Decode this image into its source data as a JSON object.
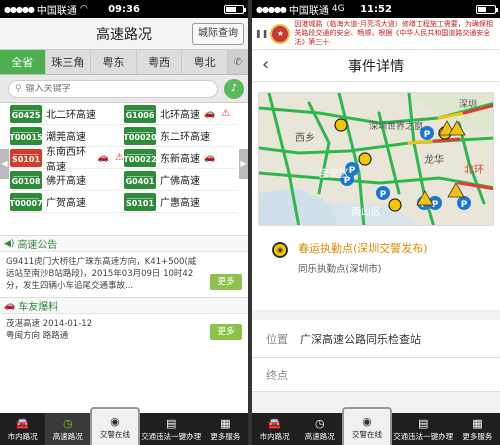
{
  "left": {
    "status": {
      "carrier": "中国联通",
      "network": "4G",
      "time": "09:36",
      "battery_level": 0.6
    },
    "nav": {
      "title": "高速路况",
      "city_button": "城际查询"
    },
    "regions": [
      "全省",
      "珠三角",
      "粤东",
      "粤西",
      "粤北"
    ],
    "search": {
      "placeholder": "输入关键字"
    },
    "roads": [
      {
        "code": "G0425",
        "name": "北二环高速",
        "color": "green",
        "car": false,
        "warn": false
      },
      {
        "code": "G1006",
        "name": "北环高速",
        "color": "green",
        "car": true,
        "warn": true
      },
      {
        "code": "T00015",
        "name": "潮莞高速",
        "color": "green",
        "car": false,
        "warn": false
      },
      {
        "code": "T00020",
        "name": "东二环高速",
        "color": "green",
        "car": false,
        "warn": false
      },
      {
        "code": "S0101",
        "name": "东南西环高速",
        "color": "red",
        "car": true,
        "warn": true
      },
      {
        "code": "T00022",
        "name": "东新高速",
        "color": "green",
        "car": true,
        "warn": false
      },
      {
        "code": "G0108",
        "name": "佛开高速",
        "color": "green",
        "car": false,
        "warn": false
      },
      {
        "code": "G0401",
        "name": "广佛高速",
        "color": "green",
        "car": false,
        "warn": false
      },
      {
        "code": "T00007",
        "name": "广贺高速",
        "color": "green",
        "car": false,
        "warn": false
      },
      {
        "code": "S0101",
        "name": "广惠高速",
        "color": "green",
        "car": false,
        "warn": false
      }
    ],
    "notice": {
      "title": "高速公告",
      "text": "G9411虎门大桥往广珠东高速方向，K41+500(威远站至南沙B站路段)，2015年03月09日 10时42分，发生四辆小车追尾交通事故...",
      "more": "更多"
    },
    "reports": {
      "title": "车友爆料",
      "line1": "茂湛高速 2014-01-12",
      "line2": "粤闽方向 路路通",
      "more": "更多"
    },
    "tabs": [
      "市内路况",
      "高速路况",
      "交警在线",
      "交通违法一键办理",
      "更多服务"
    ]
  },
  "right": {
    "status": {
      "carrier": "中国联通",
      "network": "4G",
      "time": "11:52",
      "battery_level": 0.5
    },
    "banner": "因港城路（临海大道-月亮湾大道）修缮工程施工需要，为确保相关路段交通的安全、畅顺，根据《中华人民共和国道路交通安全法》第三十",
    "nav": {
      "title": "事件详情"
    },
    "map_labels": [
      "深圳",
      "深圳世界之窗",
      "龙华",
      "西乡",
      "宝安区",
      "南山区",
      "北环"
    ],
    "event": {
      "title": "春运执勤点(深圳交警发布)",
      "subtitle": "同乐执勤点(深圳市)"
    },
    "location": {
      "label": "位置",
      "value": "广深高速公路同乐检查站"
    },
    "endpoint": {
      "label": "终点"
    },
    "tabs": [
      "市内路况",
      "高速路况",
      "交警在线",
      "交通违法一键办理",
      "更多服务"
    ]
  },
  "colors": {
    "accent_green": "#4caf50",
    "badge_green": "#2e8b3a",
    "badge_red": "#d73a2a",
    "more_green": "#8bc34a",
    "event_orange": "#e08b00",
    "road_green": "#2db84b",
    "road_red": "#e53935",
    "road_yellow": "#f4c20d"
  }
}
